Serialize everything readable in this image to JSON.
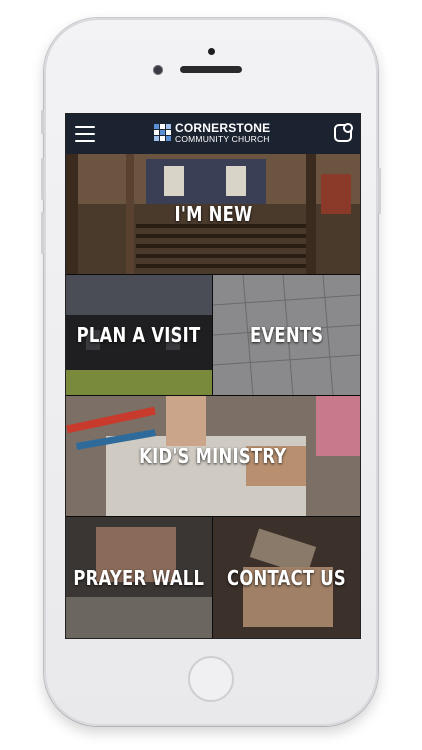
{
  "header": {
    "logo_title": "CORNERSTONE",
    "logo_subtitle": "COMMUNITY CHURCH"
  },
  "tiles": {
    "im_new": "I'M NEW",
    "plan_a_visit": "PLAN A VISIT",
    "events": "EVENTS",
    "kids_ministry": "KID'S MINISTRY",
    "prayer_wall": "PRAYER WALL",
    "contact_us": "CONTACT US"
  },
  "colors": {
    "header_bg": "#1b2230",
    "logo_accent": "#5a8fd6"
  },
  "icons": [
    "menu-icon",
    "notification-icon",
    "logo-mark-icon"
  ]
}
